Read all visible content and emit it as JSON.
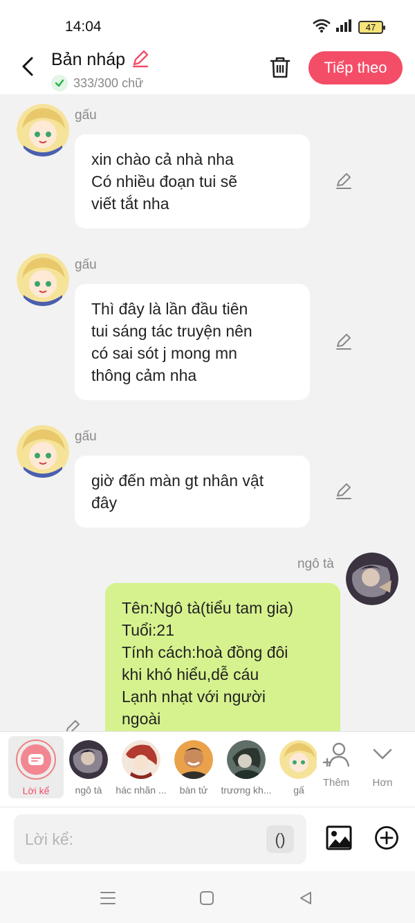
{
  "status_bar": {
    "time": "14:04",
    "battery": "47"
  },
  "header": {
    "title": "Bản nháp",
    "word_count": "333/300 chữ",
    "next_label": "Tiếp theo"
  },
  "messages": [
    {
      "sender": "gấu",
      "side": "left",
      "lines": [
        "xin chào cả nhà nha",
        "Có nhiều đoạn tui sẽ",
        "viết tắt nha"
      ]
    },
    {
      "sender": "gấu",
      "side": "left",
      "lines": [
        "Thì đây là lần đầu tiên",
        "tui sáng tác truyện nên",
        "có sai sót j mong mn",
        "thông cảm nha"
      ]
    },
    {
      "sender": "gấu",
      "side": "left",
      "lines": [
        "giờ đến màn gt nhân vật",
        "đây"
      ]
    },
    {
      "sender": "ngô tà",
      "side": "right",
      "lines": [
        "Tên:Ngô tà(tiểu tam gia)",
        "Tuổi:21",
        "Tính cách:hoà đồng đôi",
        "khi khó hiểu,dễ cáu",
        "Lạnh nhạt với người",
        "ngoài"
      ]
    }
  ],
  "characters": [
    {
      "name": "Lời kể"
    },
    {
      "name": "ngô tà"
    },
    {
      "name": "hác nhãn ..."
    },
    {
      "name": "bàn tử"
    },
    {
      "name": "trương kh..."
    },
    {
      "name": "gấ"
    }
  ],
  "actions": {
    "add_label": "Thêm",
    "more_label": "Hơn"
  },
  "input": {
    "placeholder": "Lời kể:",
    "paren_label": "()"
  },
  "colors": {
    "accent": "#f44d68",
    "green_bubble": "#d6f28e",
    "background": "#f2f2f2"
  }
}
